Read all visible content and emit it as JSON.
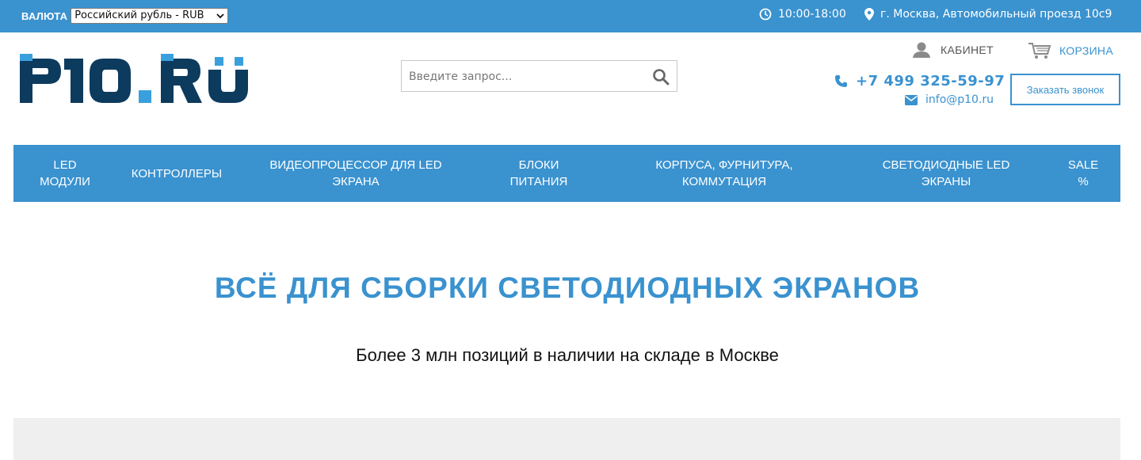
{
  "topbar": {
    "currency_label": "ВАЛЮТА",
    "currency_selected": "Российский рубль - RUB",
    "hours_icon": "clock-icon",
    "hours": "10:00-18:00",
    "address_icon": "map-marker-icon",
    "address": "г. Москва, Автомобильный проезд 10с9"
  },
  "header": {
    "logo_text": "P10.RU",
    "search_placeholder": "Введите запрос...",
    "cabinet_label": "КАБИНЕТ",
    "cart_label": "КОРЗИНА",
    "phone": "+7 499 325-59-97",
    "email": "info@p10.ru",
    "callback_label": "Заказать звонок"
  },
  "nav": {
    "items": [
      {
        "line1": "LED",
        "line2": "МОДУЛИ"
      },
      {
        "line1": "КОНТРОЛЛЕРЫ",
        "line2": ""
      },
      {
        "line1": "ВИДЕОПРОЦЕССОР ДЛЯ LED",
        "line2": "ЭКРАНА"
      },
      {
        "line1": "БЛОКИ",
        "line2": "ПИТАНИЯ"
      },
      {
        "line1": "КОРПУСА, ФУРНИТУРА,",
        "line2": "КОММУТАЦИЯ"
      },
      {
        "line1": "СВЕТОДИОДНЫЕ LED",
        "line2": "ЭКРАНЫ"
      },
      {
        "line1": "SALE",
        "line2": "%"
      }
    ]
  },
  "hero": {
    "title": "ВСЁ ДЛЯ СБОРКИ СВЕТОДИОДНЫХ ЭКРАНОВ",
    "subtitle": "Более 3 млн позиций в наличии на складе в Москве"
  },
  "colors": {
    "brand_blue": "#3a92cf",
    "logo_dark": "#0d3b5e",
    "logo_light": "#3aa0dd"
  }
}
